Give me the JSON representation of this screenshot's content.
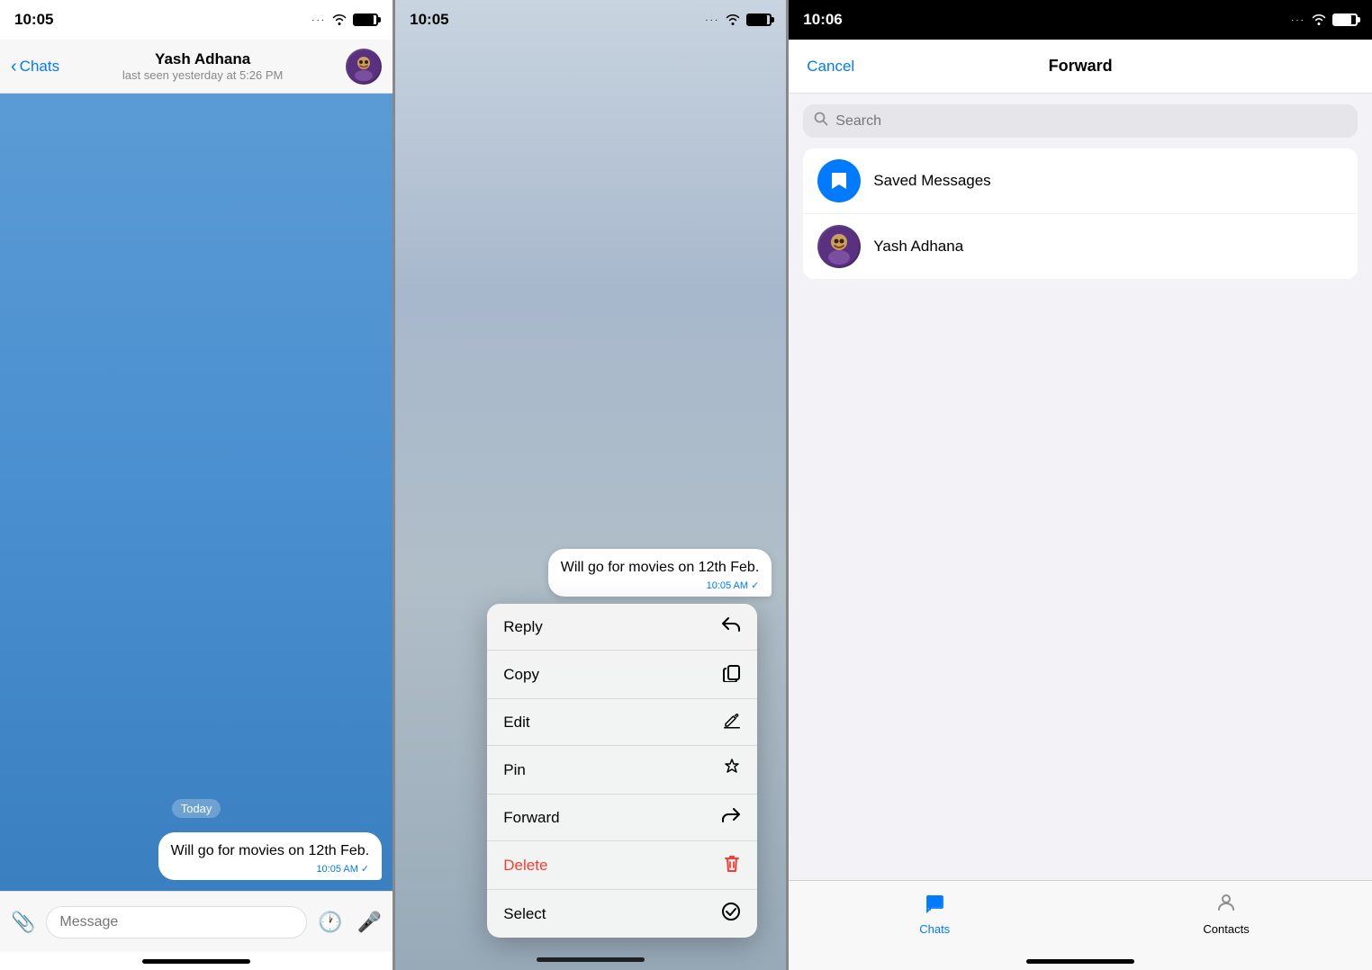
{
  "panel1": {
    "status": {
      "time": "10:05"
    },
    "navbar": {
      "back_label": "Chats",
      "contact_name": "Yash Adhana",
      "contact_status": "last seen yesterday at 5:26 PM"
    },
    "chat": {
      "date_badge": "Today",
      "message_text": "Will go for movies on 12th Feb.",
      "message_time": "10:05 AM",
      "check": "✓"
    },
    "input": {
      "placeholder": "Message"
    }
  },
  "panel2": {
    "status": {
      "time": "10:05"
    },
    "message_text": "Will go for movies on 12th Feb.",
    "message_time": "10:05 AM",
    "check": "✓",
    "menu": {
      "items": [
        {
          "label": "Reply",
          "icon": "↩",
          "type": "normal"
        },
        {
          "label": "Copy",
          "icon": "⧉",
          "type": "normal"
        },
        {
          "label": "Edit",
          "icon": "✎",
          "type": "normal"
        },
        {
          "label": "Pin",
          "icon": "🖊",
          "type": "normal"
        },
        {
          "label": "Forward",
          "icon": "↪",
          "type": "normal"
        },
        {
          "label": "Delete",
          "icon": "🗑",
          "type": "delete"
        },
        {
          "label": "Select",
          "icon": "✓",
          "type": "normal"
        }
      ]
    }
  },
  "panel3": {
    "status": {
      "time": "10:06"
    },
    "navbar": {
      "cancel_label": "Cancel",
      "title": "Forward"
    },
    "search": {
      "placeholder": "Search"
    },
    "list": {
      "items": [
        {
          "name": "Saved Messages",
          "type": "saved"
        },
        {
          "name": "Yash Adhana",
          "type": "contact"
        }
      ]
    },
    "tabs": [
      {
        "label": "Chats",
        "icon": "💬",
        "selected": true
      },
      {
        "label": "Contacts",
        "icon": "👤",
        "selected": false
      }
    ]
  }
}
